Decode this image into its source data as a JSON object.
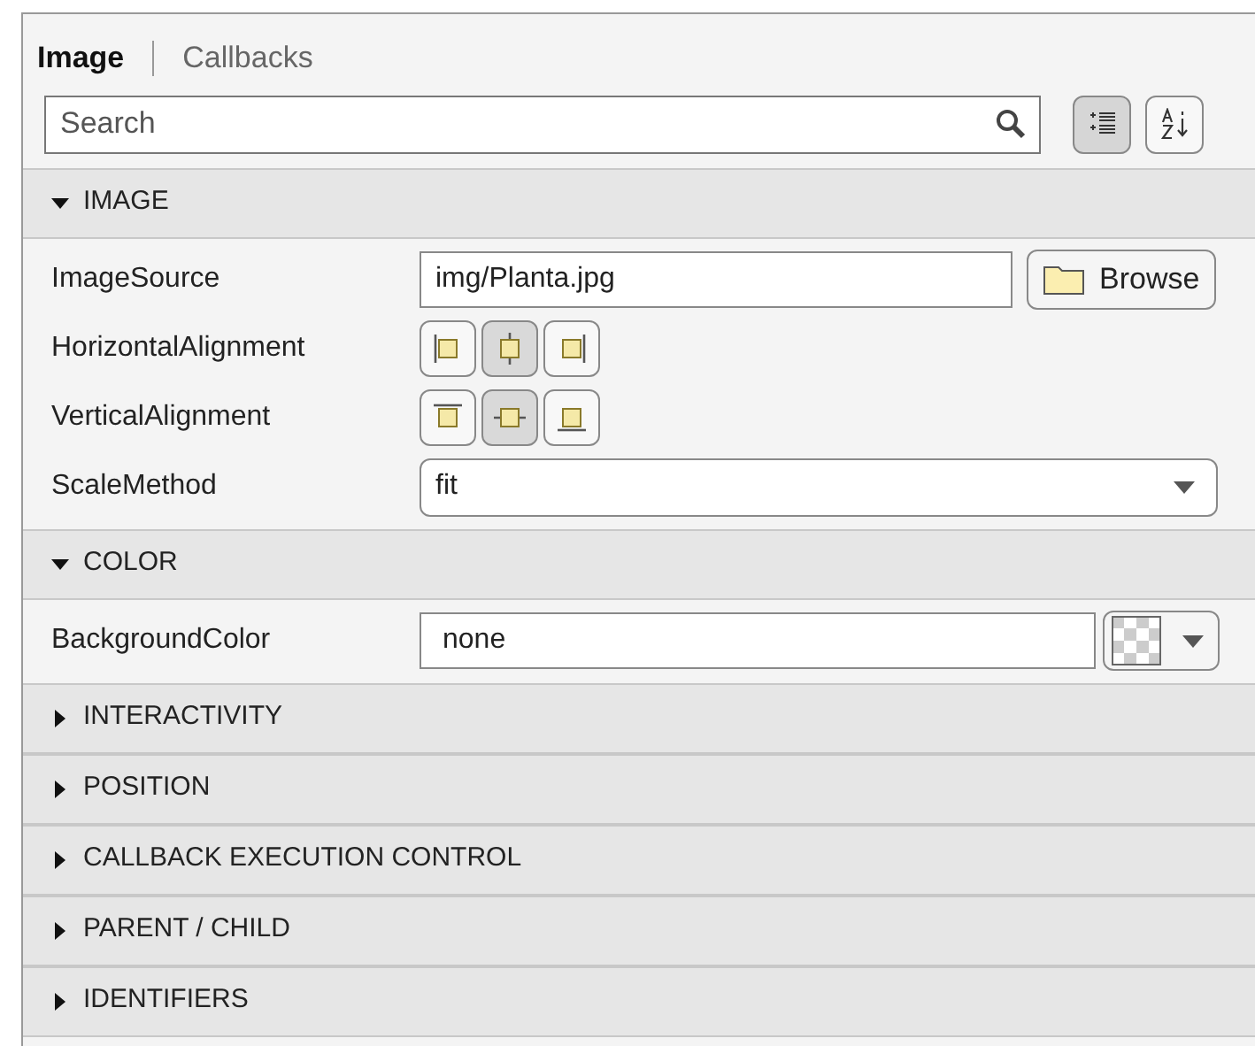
{
  "tabs": [
    {
      "label": "Image",
      "selected": true
    },
    {
      "label": "Callbacks",
      "selected": false
    }
  ],
  "search": {
    "placeholder": "Search"
  },
  "view_buttons": [
    {
      "kind": "grouped",
      "selected": true
    },
    {
      "kind": "alphabetical",
      "selected": false
    }
  ],
  "sections": [
    {
      "title": "IMAGE",
      "expanded": true,
      "properties": [
        {
          "kind": "file",
          "label": "ImageSource",
          "value": "img/Planta.jpg",
          "button": "Browse"
        },
        {
          "kind": "align",
          "label": "HorizontalAlignment",
          "options": [
            {
              "kind": "left",
              "selected": false
            },
            {
              "kind": "center",
              "selected": true
            },
            {
              "kind": "right",
              "selected": false
            }
          ]
        },
        {
          "kind": "align",
          "label": "VerticalAlignment",
          "options": [
            {
              "kind": "top",
              "selected": false
            },
            {
              "kind": "middle",
              "selected": true
            },
            {
              "kind": "bottom",
              "selected": false
            }
          ]
        },
        {
          "kind": "dropdown",
          "label": "ScaleMethod",
          "value": "fit"
        }
      ]
    },
    {
      "title": "COLOR",
      "expanded": true,
      "properties": [
        {
          "kind": "color",
          "label": "BackgroundColor",
          "value": "none"
        }
      ]
    },
    {
      "title": "INTERACTIVITY",
      "expanded": false
    },
    {
      "title": "POSITION",
      "expanded": false
    },
    {
      "title": "CALLBACK EXECUTION CONTROL",
      "expanded": false
    },
    {
      "title": "PARENT / CHILD",
      "expanded": false
    },
    {
      "title": "IDENTIFIERS",
      "expanded": false
    }
  ]
}
